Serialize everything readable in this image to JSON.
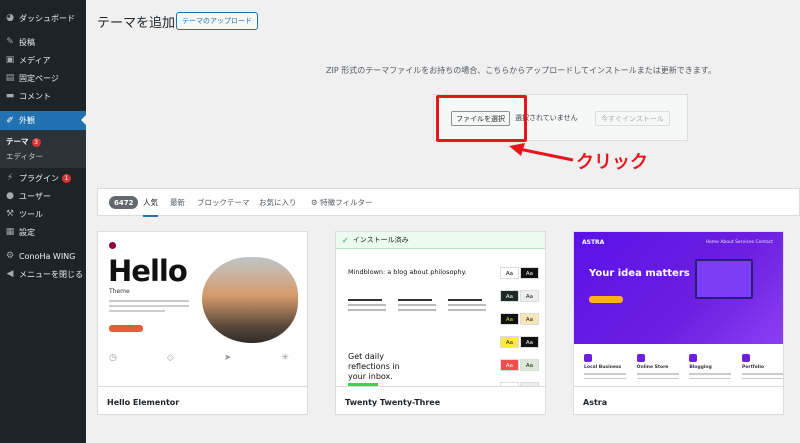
{
  "sidebar": {
    "items": [
      {
        "label": "ダッシュボード",
        "icon": "dashboard-icon"
      },
      {
        "label": "投稿",
        "icon": "pin-icon"
      },
      {
        "label": "メディア",
        "icon": "media-icon"
      },
      {
        "label": "固定ページ",
        "icon": "page-icon"
      },
      {
        "label": "コメント",
        "icon": "comment-icon"
      },
      {
        "label": "外観",
        "icon": "brush-icon"
      },
      {
        "label": "プラグイン",
        "icon": "plugin-icon",
        "badge": "1"
      },
      {
        "label": "ユーザー",
        "icon": "user-icon"
      },
      {
        "label": "ツール",
        "icon": "wrench-icon"
      },
      {
        "label": "設定",
        "icon": "settings-icon"
      },
      {
        "label": "ConoHa WING",
        "icon": "gear-icon"
      },
      {
        "label": "メニューを閉じる",
        "icon": "collapse-icon"
      }
    ],
    "submenu": {
      "theme_label": "テーマ",
      "theme_badge": "3",
      "editor_label": "エディター"
    }
  },
  "header": {
    "title": "テーマを追加",
    "upload_button": "テーマのアップロード"
  },
  "upload": {
    "message": "ZIP 形式のテーマファイルをお持ちの場合、こちらからアップロードしてインストールまたは更新できます。",
    "file_button": "ファイルを選択",
    "file_status": "選択されていません",
    "install_button": "今すぐインストール"
  },
  "annotation": {
    "label": "クリック",
    "color": "#e8151c"
  },
  "filter": {
    "count": "6472",
    "tabs": [
      "人気",
      "最新",
      "ブロックテーマ",
      "お気に入り"
    ],
    "feature_filter": "特徴フィルター"
  },
  "themes": [
    {
      "name": "Hello Elementor",
      "preview": {
        "title": "Hello",
        "subtitle": "Theme"
      }
    },
    {
      "name": "Twenty Twenty-Three",
      "installed_label": "インストール済み",
      "preview": {
        "headline": "Mindblown: a blog about philosophy.",
        "daily": "Get daily reflections in your inbox.",
        "swatch": "Aa"
      }
    },
    {
      "name": "Astra",
      "preview": {
        "logo": "ASTRA",
        "nav": "Home   About   Services   Contact",
        "headline": "Your idea matters",
        "cols": [
          "Local Business",
          "Online Store",
          "Blogging",
          "Portfolio"
        ]
      }
    }
  ],
  "colors": {
    "sidebar": "#1d2327",
    "accent": "#2271b1",
    "badge": "#d63638"
  }
}
